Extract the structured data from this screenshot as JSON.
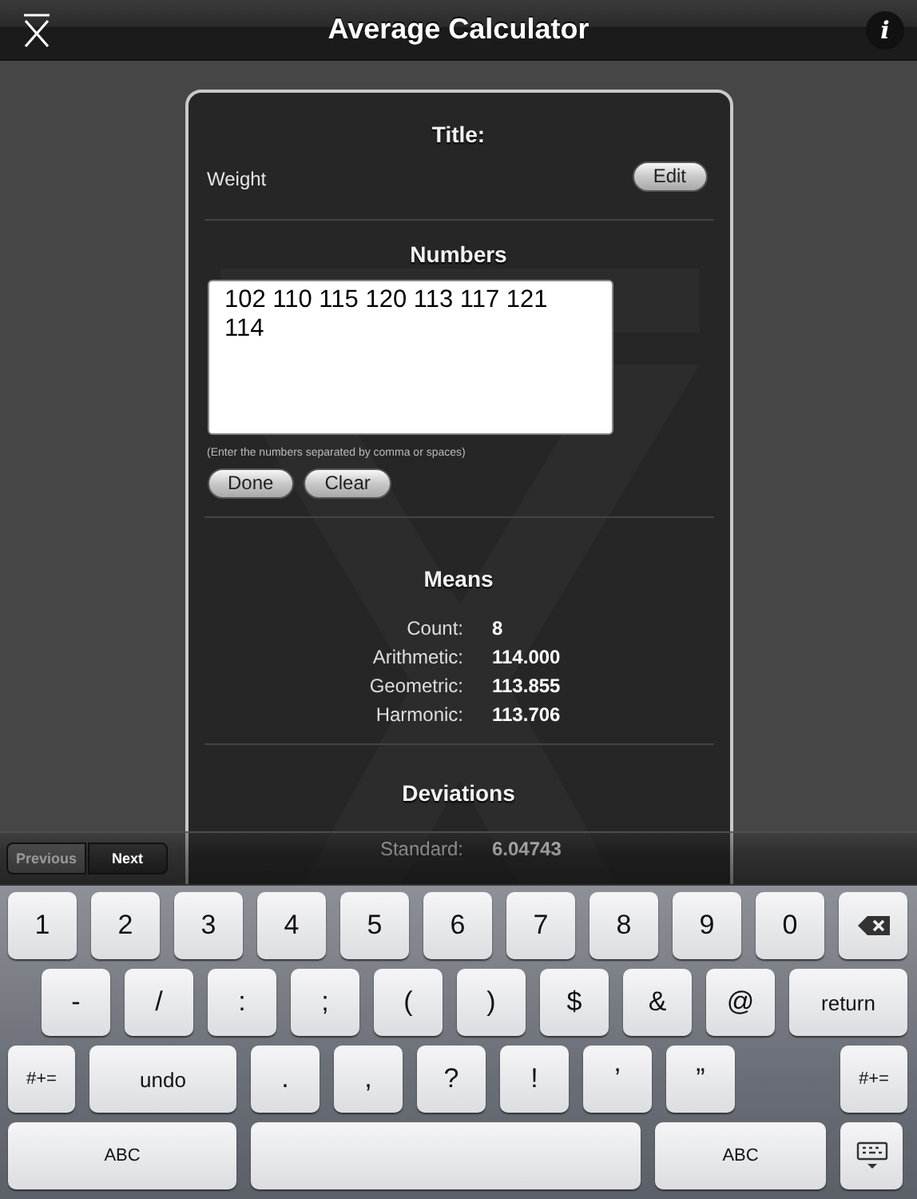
{
  "nav_bar": {
    "title": "Average Calculator",
    "info_button": "i"
  },
  "card": {
    "title_section": {
      "heading": "Title:",
      "value": "Weight",
      "edit_button": "Edit"
    },
    "numbers_section": {
      "heading": "Numbers",
      "value": "102 110 115 120 113 117 121 114",
      "hint": "(Enter the numbers separated by comma or spaces)",
      "buttons": [
        "Done",
        "Clear"
      ]
    },
    "means": {
      "heading": "Means",
      "rows": [
        {
          "label": "Count:",
          "value": "8"
        },
        {
          "label": "Arithmetic:",
          "value": "114.000"
        },
        {
          "label": "Geometric:",
          "value": "113.855"
        },
        {
          "label": "Harmonic:",
          "value": "113.706"
        }
      ]
    },
    "deviations": {
      "heading": "Deviations",
      "rows": [
        {
          "label": "Standard:",
          "value": "6.04743"
        }
      ]
    }
  },
  "toolbar": {
    "buttons": [
      {
        "label": "Previous",
        "disabled": true
      },
      {
        "label": "Next",
        "disabled": false
      }
    ]
  },
  "keyboard": {
    "rows": [
      [
        {
          "kind": "char",
          "label": "1"
        },
        {
          "kind": "char",
          "label": "2"
        },
        {
          "kind": "char",
          "label": "3"
        },
        {
          "kind": "char",
          "label": "4"
        },
        {
          "kind": "char",
          "label": "5"
        },
        {
          "kind": "char",
          "label": "6"
        },
        {
          "kind": "char",
          "label": "7"
        },
        {
          "kind": "char",
          "label": "8"
        },
        {
          "kind": "char",
          "label": "9"
        },
        {
          "kind": "char",
          "label": "0"
        },
        {
          "kind": "delete"
        }
      ],
      [
        {
          "kind": "char",
          "label": "-"
        },
        {
          "kind": "char",
          "label": "/"
        },
        {
          "kind": "char",
          "label": ":"
        },
        {
          "kind": "char",
          "label": ";"
        },
        {
          "kind": "char",
          "label": "("
        },
        {
          "kind": "char",
          "label": ")"
        },
        {
          "kind": "char",
          "label": "$"
        },
        {
          "kind": "char",
          "label": "&"
        },
        {
          "kind": "char",
          "label": "@"
        },
        {
          "kind": "return",
          "label": "return"
        }
      ],
      [
        {
          "kind": "mode",
          "label": "#+="
        },
        {
          "kind": "undo",
          "label": "undo"
        },
        {
          "kind": "char",
          "label": "."
        },
        {
          "kind": "char",
          "label": ","
        },
        {
          "kind": "char",
          "label": "?"
        },
        {
          "kind": "char",
          "label": "!"
        },
        {
          "kind": "char",
          "label": "’"
        },
        {
          "kind": "char",
          "label": "”"
        },
        {
          "kind": "mode",
          "label": "#+="
        }
      ],
      [
        {
          "kind": "abc",
          "label": "ABC"
        },
        {
          "kind": "space"
        },
        {
          "kind": "abc2",
          "label": "ABC"
        },
        {
          "kind": "hide"
        }
      ]
    ]
  }
}
